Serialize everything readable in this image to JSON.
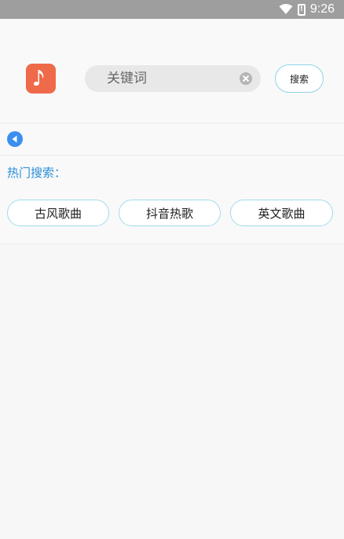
{
  "status_bar": {
    "time": "9:26",
    "battery_glyph": "!"
  },
  "app": {
    "logo_icon": "music-note-icon",
    "accent_color": "#ef6a4a"
  },
  "search": {
    "placeholder": "关键词",
    "value": "",
    "button_label": "搜索"
  },
  "hot": {
    "title": "热门搜索：",
    "tags": [
      "古风歌曲",
      "抖音热歌",
      "英文歌曲"
    ]
  },
  "colors": {
    "link_blue": "#2a8fd6",
    "tag_border": "#9fdcec"
  }
}
